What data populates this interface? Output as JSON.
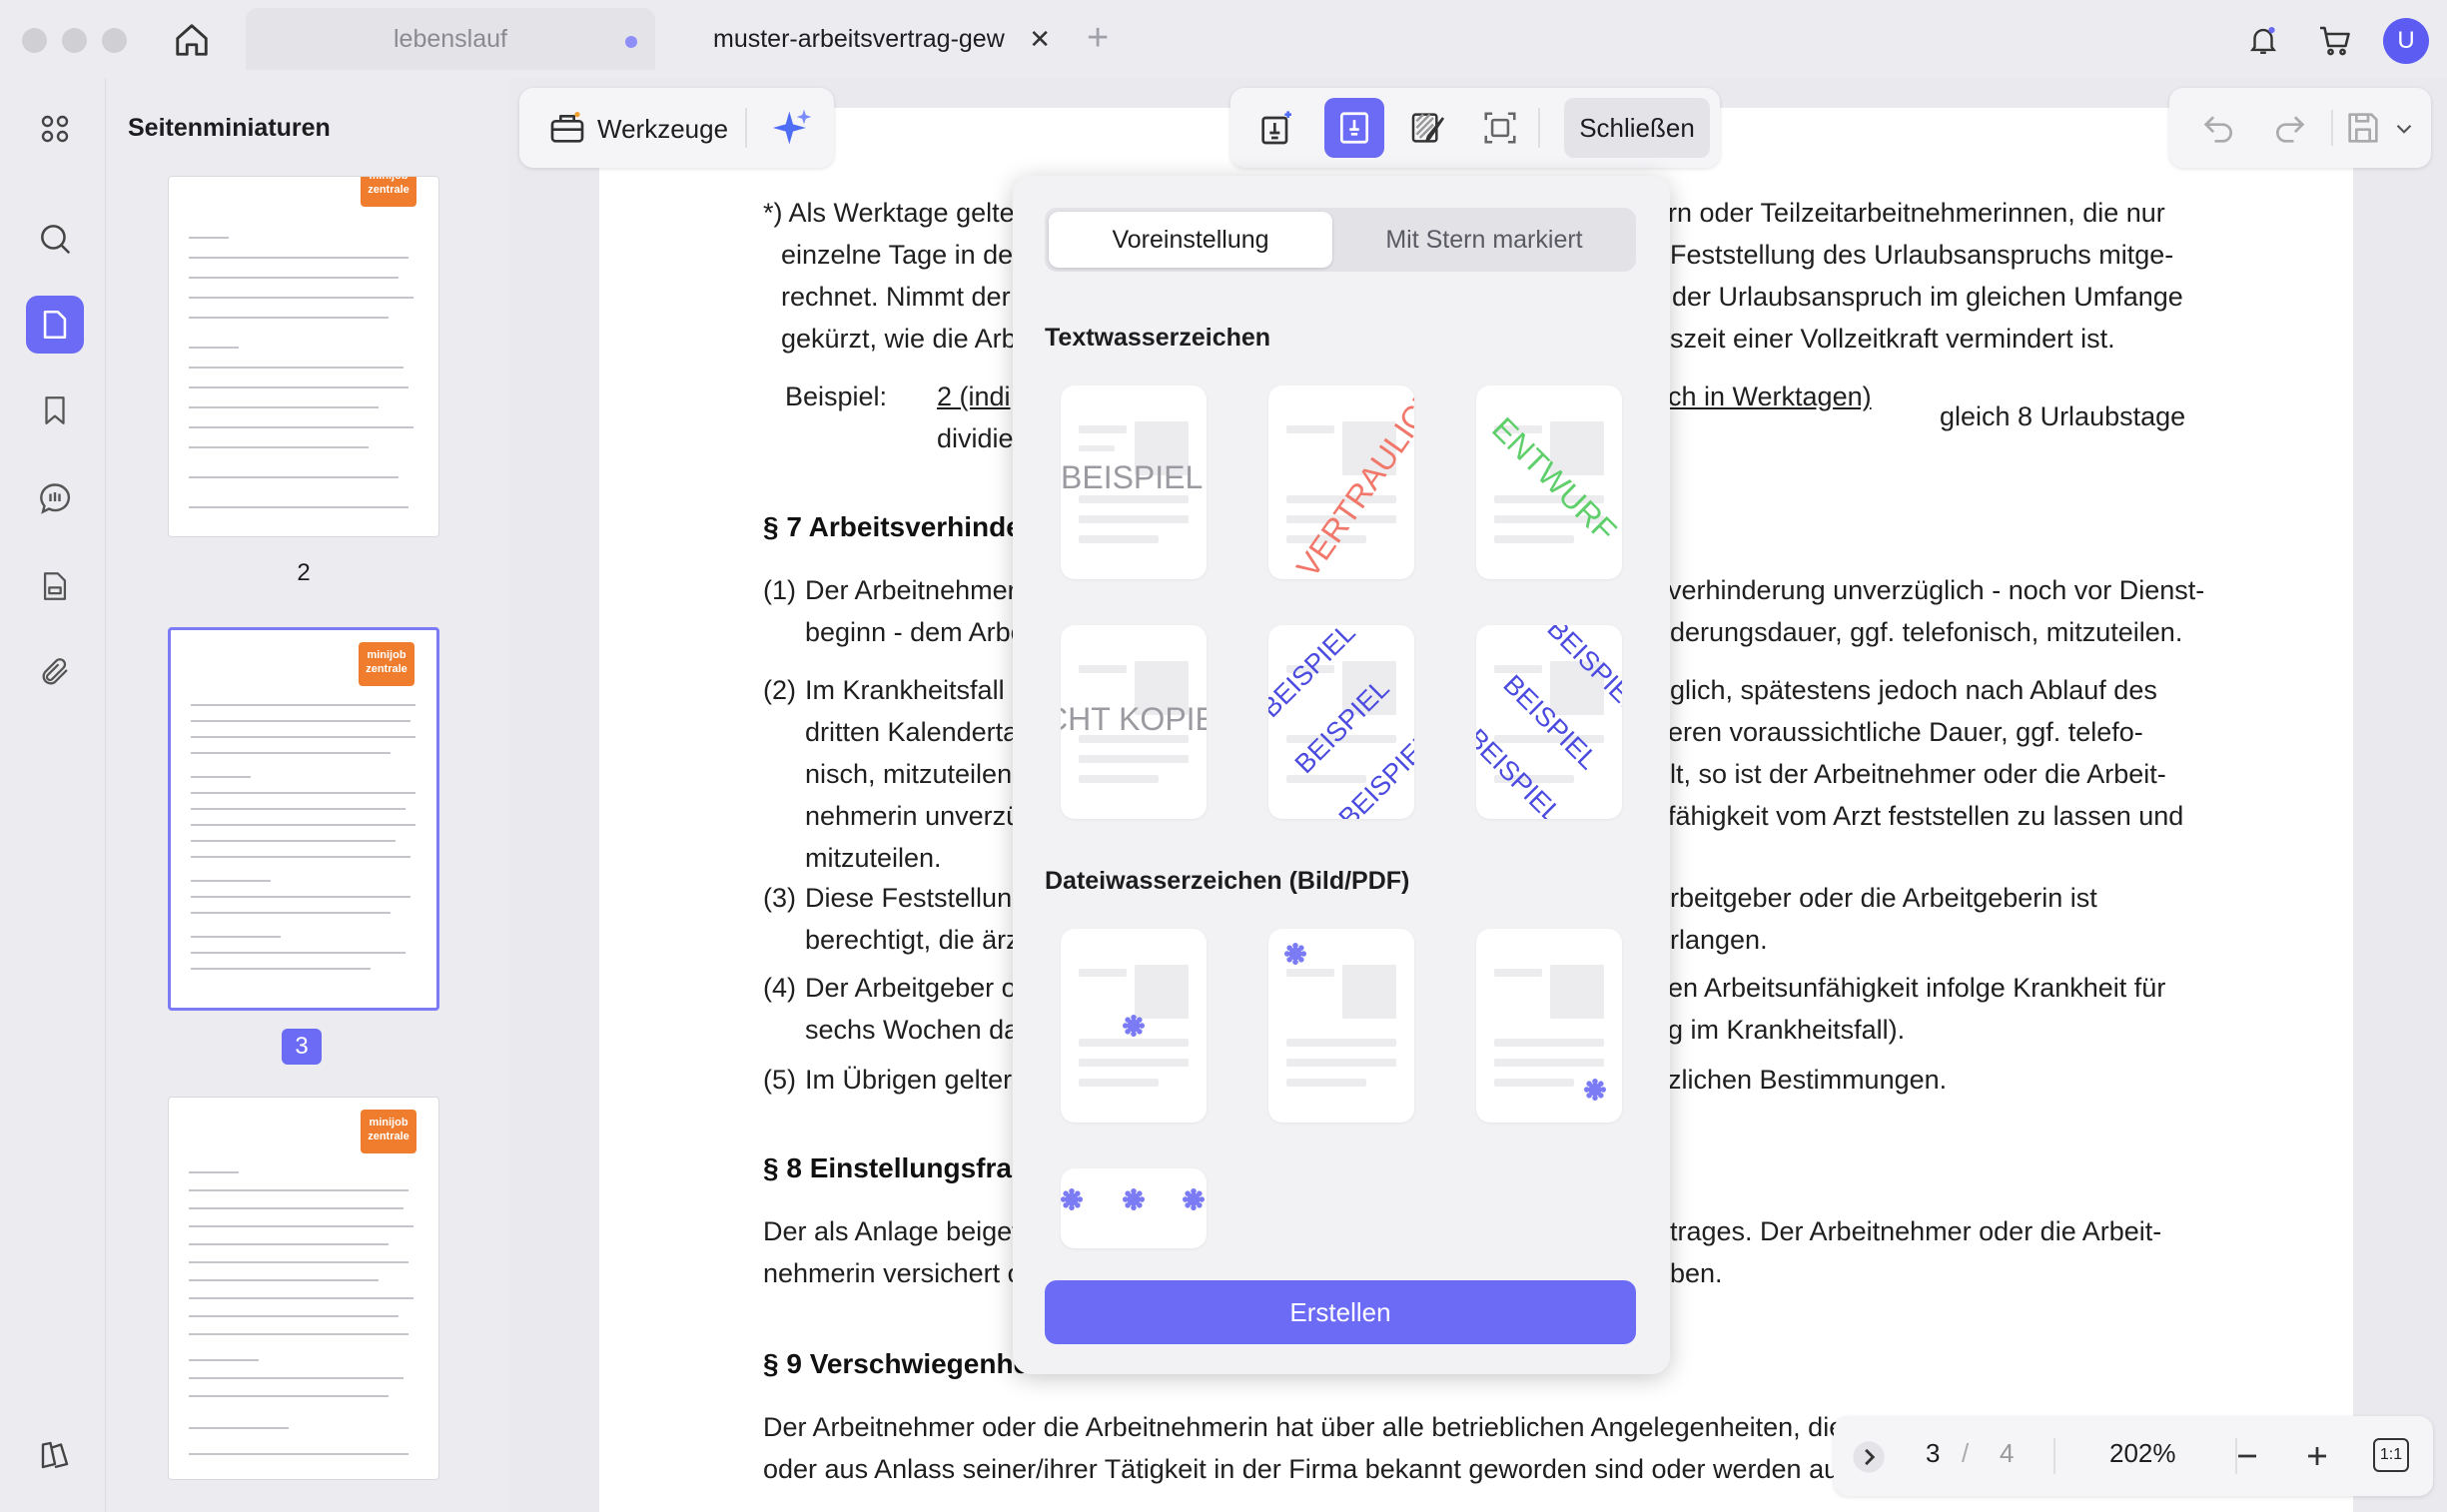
{
  "tabs": [
    {
      "label": "lebenslauf"
    },
    {
      "label": "muster-arbeitsvertrag-gew"
    }
  ],
  "user": {
    "initial": "U"
  },
  "sidebar": {
    "title": "Seitenminiaturen"
  },
  "thumbnails": [
    {
      "page": "2",
      "logo": "minijob zentrale"
    },
    {
      "page": "3",
      "logo": "minijob zentrale"
    },
    {
      "page": "",
      "logo": "minijob zentrale"
    }
  ],
  "toolbar": {
    "tools_label": "Werkzeuge",
    "close_label": "Schließen"
  },
  "watermark_panel": {
    "tab_preset": "Voreinstellung",
    "tab_starred": "Mit Stern markiert",
    "text_section": "Textwasserzeichen",
    "file_section": "Dateiwasserzeichen (Bild/PDF)",
    "text_presets": [
      "BEISPIEL",
      "VERTRAULICH",
      "ENTWURF",
      "NICHT KOPIEREN",
      "BEISPIEL",
      "BEISPIEL"
    ],
    "create_label": "Erstellen",
    "colors": {
      "gray": "#9a9aa0",
      "red": "#f0776a",
      "green": "#5fcf6b",
      "blue": "#4b4be0",
      "accent": "#6b6bf5"
    }
  },
  "document": {
    "lines": [
      "*) Als Werktage gelten",
      "einzelne Tage in der",
      "rechnet. Nimmt der",
      "gekürzt, wie die Arb",
      "Beispiel:",
      "2 (indi",
      "dividie",
      "§ 7 Arbeitsverhinde",
      "(1)",
      "Der Arbeitnehmer",
      "beginn - dem Arbe",
      "(2)",
      "Im Krankheitsfall",
      "dritten Kalenderta",
      "nisch, mitzuteilen",
      "nehmerin unverzü",
      "mitzuteilen.",
      "(3)",
      "Diese Feststellung",
      "berechtigt, die ärz",
      "(4)",
      "Der Arbeitgeber o",
      "sechs Wochen da",
      "(5)",
      "Im Übrigen gelter",
      "§ 8 Einstellungsfrag",
      "Der als Anlage beigef",
      "nehmerin versichert o",
      "§ 9 Verschwiegenhe",
      "Der Arbeitnehmer oder die Arbeitnehmerin hat über alle betrieblichen Angelegenheiten, die",
      "oder aus Anlass seiner/ihrer Tätigkeit in der Firma bekannt geworden sind oder werden auc",
      "rn oder Teilzeitarbeitnehmerinnen, die nur",
      "Feststellung des Urlaubsanspruchs mitge-",
      "der Urlaubsanspruch im gleichen Umfange",
      "szeit einer Vollzeitkraft vermindert ist.",
      "ch in Werktagen)",
      "gleich 8 Urlaubstage",
      "verhinderung unverzüglich - noch vor Dienst-",
      "derungsdauer, ggf. telefonisch, mitzuteilen.",
      "glich, spätestens jedoch nach Ablauf des",
      "eren voraussichtliche Dauer, ggf. telefo-",
      "lt, so ist der Arbeitnehmer oder die Arbeit-",
      "fähigkeit vom Arzt feststellen zu lassen und",
      "rbeitgeber oder die Arbeitgeberin ist",
      "rlangen.",
      "en Arbeitsunfähigkeit infolge Krankheit für",
      "g im Krankheitsfall).",
      "zlichen Bestimmungen.",
      "trages. Der Arbeitnehmer oder die Arbeit-",
      "ben."
    ]
  },
  "bottom_nav": {
    "current_page": "3",
    "separator": "/",
    "total_pages": "4",
    "zoom": "202%",
    "fit_label": "1:1"
  }
}
